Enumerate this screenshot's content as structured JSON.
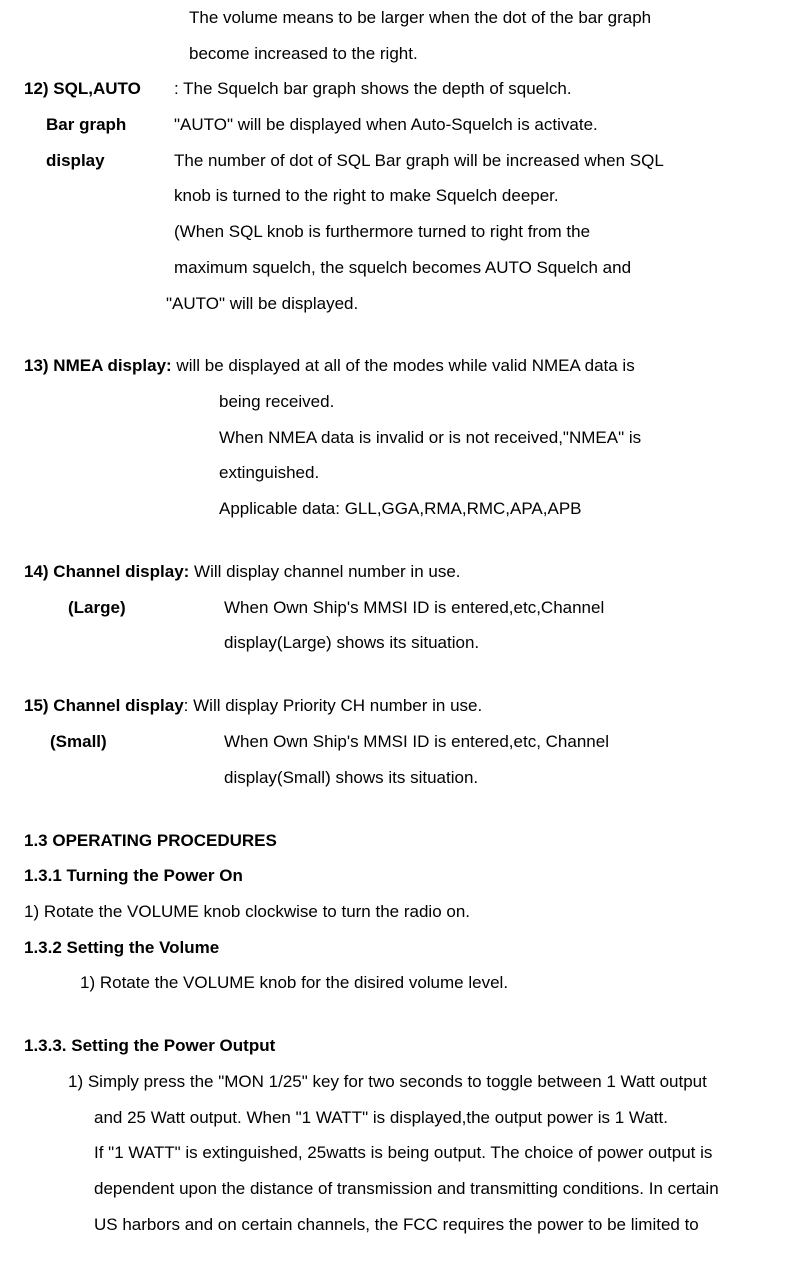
{
  "lines": {
    "vol_line1": "The volume means to be larger when the dot of the bar graph",
    "vol_line2": "become increased to the right.",
    "item12_label_a": "12) SQL,AUTO",
    "item12_label_b": "Bar graph",
    "item12_label_c": "display",
    "item12_body_a": ": The Squelch bar graph shows the depth of squelch.",
    "item12_body_b": " \"AUTO\" will be displayed when Auto-Squelch is activate.",
    "item12_body_c": "The number of dot of SQL Bar graph will be increased when SQL",
    "item12_body_d": " knob is turned to the right to make Squelch deeper.",
    "item12_body_e": "(When SQL knob is furthermore turned to right from the",
    "item12_body_f": "maximum squelch, the squelch becomes AUTO Squelch and",
    "item12_body_g": "\"AUTO\" will be displayed.",
    "item13_head": "13) NMEA display:",
    "item13_rest": " will be displayed at all of the modes while valid NMEA data is",
    "item13_b": " being received.",
    "item13_c": "When NMEA data is invalid or is not received,\"NMEA\" is",
    "item13_d": "extinguished.",
    "item13_e": "Applicable data: GLL,GGA,RMA,RMC,APA,APB",
    "item14_head": "14) Channel display:",
    "item14_rest": " Will display channel number in use.",
    "item14_label": "(Large)",
    "item14_b": "When Own Ship's MMSI ID is entered,etc,Channel",
    "item14_c": "display(Large) shows its situation.",
    "item15_head": "15) Channel display",
    "item15_rest": ": Will display Priority CH number in use.",
    "item15_label": "(Small)",
    "item15_b": "When Own Ship's MMSI ID is entered,etc, Channel",
    "item15_c": "display(Small) shows its situation.",
    "s13": "1.3 OPERATING PROCEDURES",
    "s131": "1.3.1     Turning the Power On",
    "s131_1": "1) Rotate the VOLUME knob clockwise to turn the radio on.",
    "s132": "1.3.2    Setting the Volume",
    "s132_1": "1) Rotate the VOLUME knob for the disired volume level.",
    "s133": "1.3.3.   Setting the Power Output",
    "s133_1": "1) Simply press the \"MON 1/25\" key for two seconds to toggle between 1 Watt output",
    "s133_2": "and 25 Watt output.  When \"1 WATT\" is displayed,the output power is 1 Watt.",
    "s133_3": "If \"1 WATT\" is extinguished, 25watts is being output. The choice of power output is",
    "s133_4": "dependent upon the distance of transmission and transmitting conditions. In certain",
    "s133_5": "US harbors and on certain channels, the FCC requires the power to be limited to"
  }
}
